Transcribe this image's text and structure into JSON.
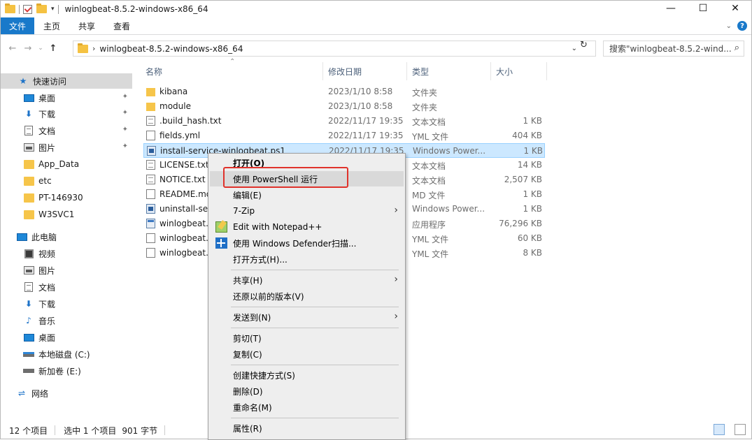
{
  "window": {
    "title": "winlogbeat-8.5.2-windows-x86_64"
  },
  "ribbon": {
    "tabs": [
      "文件",
      "主页",
      "共享",
      "查看"
    ]
  },
  "address": {
    "path": "winlogbeat-8.5.2-windows-x86_64"
  },
  "search": {
    "placeholder": "搜索\"winlogbeat-8.5.2-wind..."
  },
  "nav": {
    "quick_access": "快速访问",
    "items": [
      "桌面",
      "下载",
      "文档",
      "图片",
      "App_Data",
      "etc",
      "PT-146930",
      "W3SVC1"
    ],
    "this_pc": "此电脑",
    "pc_items": [
      "视频",
      "图片",
      "文档",
      "下载",
      "音乐",
      "桌面",
      "本地磁盘 (C:)",
      "新加卷 (E:)"
    ],
    "network": "网络"
  },
  "columns": {
    "name": "名称",
    "date": "修改日期",
    "type": "类型",
    "size": "大小"
  },
  "files": [
    {
      "name": "kibana",
      "date": "2023/1/10 8:58",
      "type": "文件夹",
      "size": "",
      "icon": "folder"
    },
    {
      "name": "module",
      "date": "2023/1/10 8:58",
      "type": "文件夹",
      "size": "",
      "icon": "folder"
    },
    {
      "name": ".build_hash.txt",
      "date": "2022/11/17 19:35",
      "type": "文本文档",
      "size": "1 KB",
      "icon": "txt"
    },
    {
      "name": "fields.yml",
      "date": "2022/11/17 19:35",
      "type": "YML 文件",
      "size": "404 KB",
      "icon": "plain"
    },
    {
      "name": "install-service-winlogbeat.ps1",
      "date": "2022/11/17 19:35",
      "type": "Windows Power...",
      "size": "1 KB",
      "icon": "ps1"
    },
    {
      "name": "LICENSE.txt",
      "date": "",
      "type": "文本文档",
      "size": "14 KB",
      "icon": "txt"
    },
    {
      "name": "NOTICE.txt",
      "date": "",
      "type": "文本文档",
      "size": "2,507 KB",
      "icon": "txt"
    },
    {
      "name": "README.md",
      "date": "",
      "type": "MD 文件",
      "size": "1 KB",
      "icon": "plain"
    },
    {
      "name": "uninstall-service-winlogbeat.ps1",
      "date": "",
      "type": "Windows Power...",
      "size": "1 KB",
      "icon": "ps1"
    },
    {
      "name": "winlogbeat.exe",
      "date": "",
      "type": "应用程序",
      "size": "76,296 KB",
      "icon": "exe"
    },
    {
      "name": "winlogbeat.reference.yml",
      "date": "",
      "type": "YML 文件",
      "size": "60 KB",
      "icon": "plain"
    },
    {
      "name": "winlogbeat.yml",
      "date": "",
      "type": "YML 文件",
      "size": "8 KB",
      "icon": "plain"
    }
  ],
  "context_menu": {
    "open": "打开(O)",
    "run_ps": "使用 PowerShell 运行",
    "edit": "编辑(E)",
    "zip": "7-Zip",
    "notepad": "Edit with Notepad++",
    "defender": "使用 Windows Defender扫描...",
    "open_with": "打开方式(H)...",
    "share": "共享(H)",
    "restore": "还原以前的版本(V)",
    "send_to": "发送到(N)",
    "cut": "剪切(T)",
    "copy": "复制(C)",
    "shortcut": "创建快捷方式(S)",
    "delete": "删除(D)",
    "rename": "重命名(M)",
    "properties": "属性(R)"
  },
  "status": {
    "count": "12 个项目",
    "selected": "选中 1 个项目",
    "bytes": "901 字节"
  }
}
